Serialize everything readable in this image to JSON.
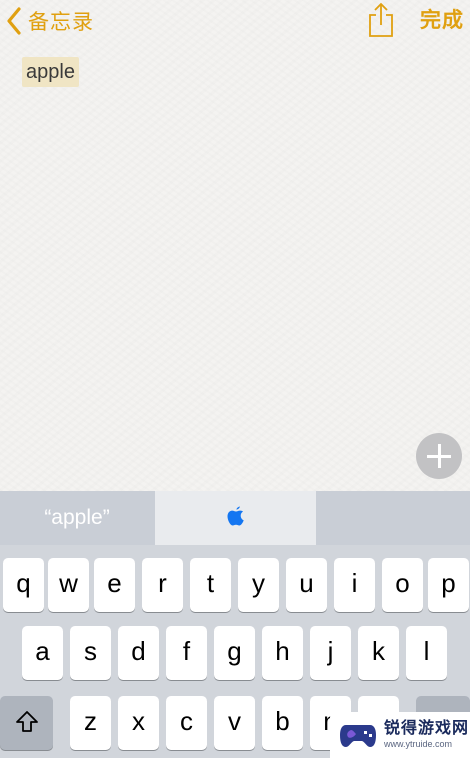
{
  "nav": {
    "back_label": "备忘录",
    "done_label": "完成",
    "accent_color": "#e0a010"
  },
  "icons": {
    "back": "chevron-left-icon",
    "share": "share-icon",
    "add": "plus-icon",
    "apple": "apple-logo-icon",
    "shift": "shift-icon"
  },
  "note": {
    "text": "apple"
  },
  "suggestions": {
    "left": "“apple”",
    "middle": "apple-logo",
    "right": ""
  },
  "keyboard": {
    "row1": [
      "q",
      "w",
      "e",
      "r",
      "t",
      "y",
      "u",
      "i",
      "o",
      "p"
    ],
    "row2": [
      "a",
      "s",
      "d",
      "f",
      "g",
      "h",
      "j",
      "k",
      "l"
    ],
    "row3": [
      "z",
      "x",
      "c",
      "v",
      "b",
      "n"
    ]
  },
  "watermark": {
    "title": "锐得游戏网",
    "url": "www.ytruide.com"
  }
}
